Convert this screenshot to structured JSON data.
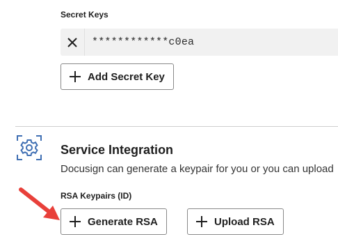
{
  "secret_keys": {
    "label": "Secret Keys",
    "masked_value": "************c0ea",
    "remove_icon": "x-icon",
    "add_button_label": "Add Secret Key"
  },
  "service_integration": {
    "icon": "gear-icon",
    "title": "Service Integration",
    "description": "Docusign can generate a keypair for you or you can upload",
    "rsa_label": "RSA Keypairs (ID)",
    "generate_button_label": "Generate RSA",
    "upload_button_label": "Upload RSA"
  },
  "annotation": {
    "arrow_color": "#e8403a"
  },
  "colors": {
    "icon_blue": "#3f6fb3",
    "border": "#888888",
    "key_row_bg": "#f1f1f1"
  }
}
